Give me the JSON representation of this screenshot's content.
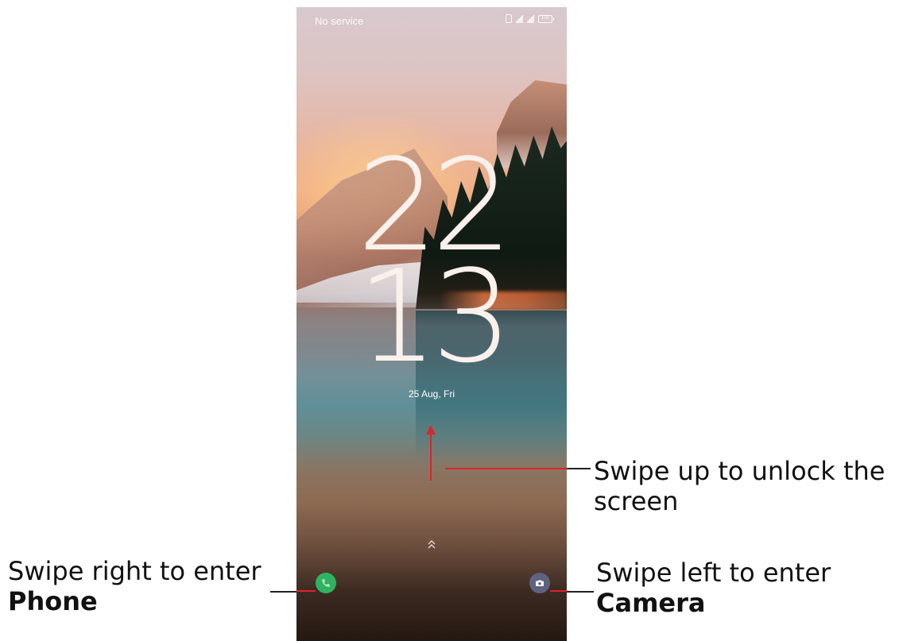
{
  "lockscreen": {
    "status_text": "No service",
    "battery_label": "100",
    "clock_hours": "22",
    "clock_minutes": "13",
    "date": "25 Aug, Fri",
    "swipe_hint_icon": "chevron-up-double-icon",
    "phone_icon": "phone-icon",
    "camera_icon": "camera-icon"
  },
  "annotations": {
    "unlock": "Swipe up to unlock the screen",
    "phone_line1": "Swipe right to enter",
    "phone_line2": "Phone",
    "camera_line1": "Swipe left to enter",
    "camera_line2": "Camera"
  },
  "colors": {
    "accent_red": "#d7262e",
    "phone_button": "#2fb360",
    "camera_button": "#5f6380"
  }
}
